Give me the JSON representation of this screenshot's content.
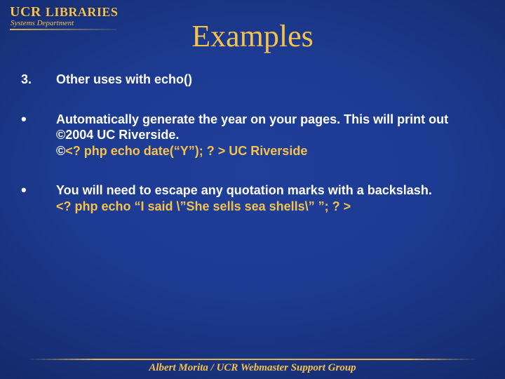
{
  "logo": {
    "ucr": "UCR",
    "libraries": "LIBRARIES",
    "sub": "Systems Department"
  },
  "title": "Examples",
  "items": [
    {
      "marker": "3.",
      "text_plain": "Other uses with echo()"
    },
    {
      "marker": "•",
      "line1": "Automatically generate the year on your pages. This will print out ©2004 UC Riverside.",
      "code_prefix": "©",
      "code_yellow": "<? php echo date(“Y”);  ? >  UC Riverside"
    },
    {
      "marker": "•",
      "line1": "You will need to escape any quotation marks with a backslash.",
      "code_yellow": "<? php  echo “I said \\”She sells sea shells\\” ”; ? >"
    }
  ],
  "footer": "Albert Morita / UCR Webmaster Support Group"
}
